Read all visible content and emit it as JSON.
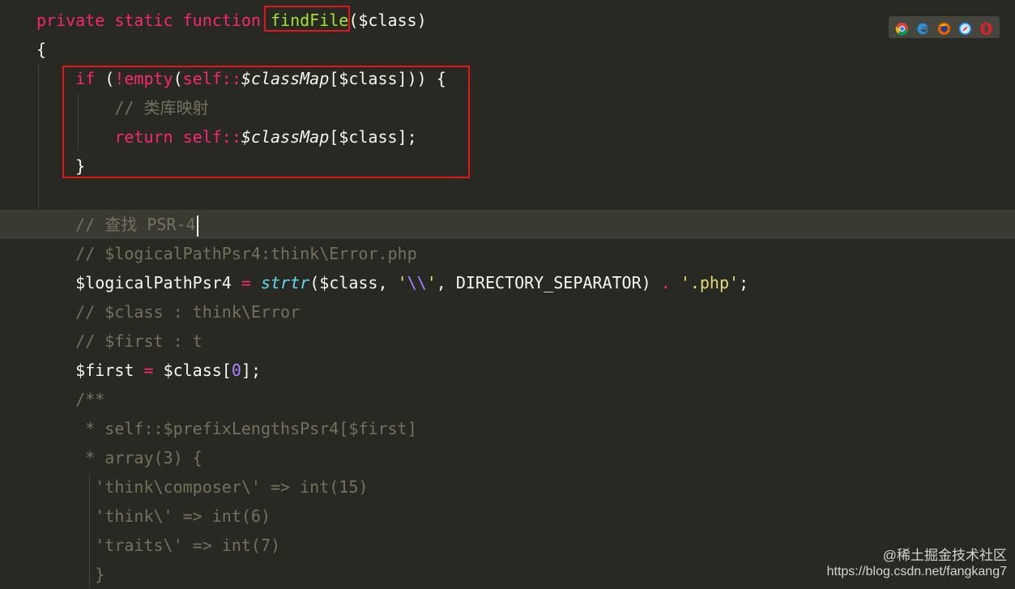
{
  "editor": {
    "theme_colors": {
      "background": "#282923",
      "keyword": "#f92672",
      "function_name": "#a6e22e",
      "comment": "#75715e",
      "string": "#e6db74",
      "number": "#ae81ff",
      "builtin_function": "#66d9ef",
      "highlight_box": "#e3141b"
    },
    "current_line_index": 7,
    "lines": [
      [
        [
          "kw",
          "private static function "
        ],
        [
          "fn",
          "findFile"
        ],
        [
          "p",
          "($class)"
        ]
      ],
      [
        [
          "p",
          "{"
        ]
      ],
      [
        [
          "p",
          "    "
        ],
        [
          "kw",
          "if "
        ],
        [
          "p",
          "("
        ],
        [
          "kw",
          "!empty"
        ],
        [
          "p",
          "("
        ],
        [
          "kw",
          "self::"
        ],
        [
          "ci",
          "$classMap"
        ],
        [
          "p",
          "[$class])) {"
        ]
      ],
      [
        [
          "p",
          "        "
        ],
        [
          "cm",
          "// 类库映射"
        ]
      ],
      [
        [
          "p",
          "        "
        ],
        [
          "kw",
          "return "
        ],
        [
          "kw",
          "self::"
        ],
        [
          "ci",
          "$classMap"
        ],
        [
          "p",
          "[$class];"
        ]
      ],
      [
        [
          "p",
          "    }"
        ]
      ],
      [],
      [
        [
          "p",
          "    "
        ],
        [
          "cm",
          "// 查找 PSR-4"
        ]
      ],
      [
        [
          "p",
          "    "
        ],
        [
          "cm",
          "// $logicalPathPsr4:think\\Error.php"
        ]
      ],
      [
        [
          "p",
          "    "
        ],
        [
          "v",
          "$logicalPathPsr4 "
        ],
        [
          "op",
          "= "
        ],
        [
          "fi",
          "strtr"
        ],
        [
          "p",
          "($class, "
        ],
        [
          "st",
          "'"
        ],
        [
          "sc",
          "\\\\"
        ],
        [
          "st",
          "'"
        ],
        [
          "p",
          ", "
        ],
        [
          "cn",
          "DIRECTORY_SEPARATOR"
        ],
        [
          "p",
          ") "
        ],
        [
          "op",
          "."
        ],
        [
          "p",
          " "
        ],
        [
          "st",
          "'.php'"
        ],
        [
          "p",
          ";"
        ]
      ],
      [
        [
          "p",
          "    "
        ],
        [
          "cm",
          "// $class : think\\Error"
        ]
      ],
      [
        [
          "p",
          "    "
        ],
        [
          "cm",
          "// $first : t"
        ]
      ],
      [
        [
          "p",
          "    "
        ],
        [
          "v",
          "$first "
        ],
        [
          "op",
          "= "
        ],
        [
          "p",
          "$class["
        ],
        [
          "num",
          "0"
        ],
        [
          "p",
          "];"
        ]
      ],
      [
        [
          "p",
          "    "
        ],
        [
          "cm",
          "/**"
        ]
      ],
      [
        [
          "p",
          "     "
        ],
        [
          "cm",
          "* self::$prefixLengthsPsr4[$first]"
        ]
      ],
      [
        [
          "p",
          "     "
        ],
        [
          "cm",
          "* array(3) {"
        ]
      ],
      [
        [
          "p",
          "      "
        ],
        [
          "cm",
          "'think\\composer\\' => int(15)"
        ]
      ],
      [
        [
          "p",
          "      "
        ],
        [
          "cm",
          "'think\\' => int(6)"
        ]
      ],
      [
        [
          "p",
          "      "
        ],
        [
          "cm",
          "'traits\\' => int(7)"
        ]
      ],
      [
        [
          "p",
          "      "
        ],
        [
          "cm",
          "}"
        ]
      ]
    ]
  },
  "browser_bar": {
    "icons": [
      "chrome-icon",
      "edge-icon",
      "firefox-icon",
      "safari-icon",
      "opera-icon"
    ]
  },
  "watermark": {
    "line1": "@稀土掘金技术社区",
    "line2": "https://blog.csdn.net/fangkang7"
  }
}
